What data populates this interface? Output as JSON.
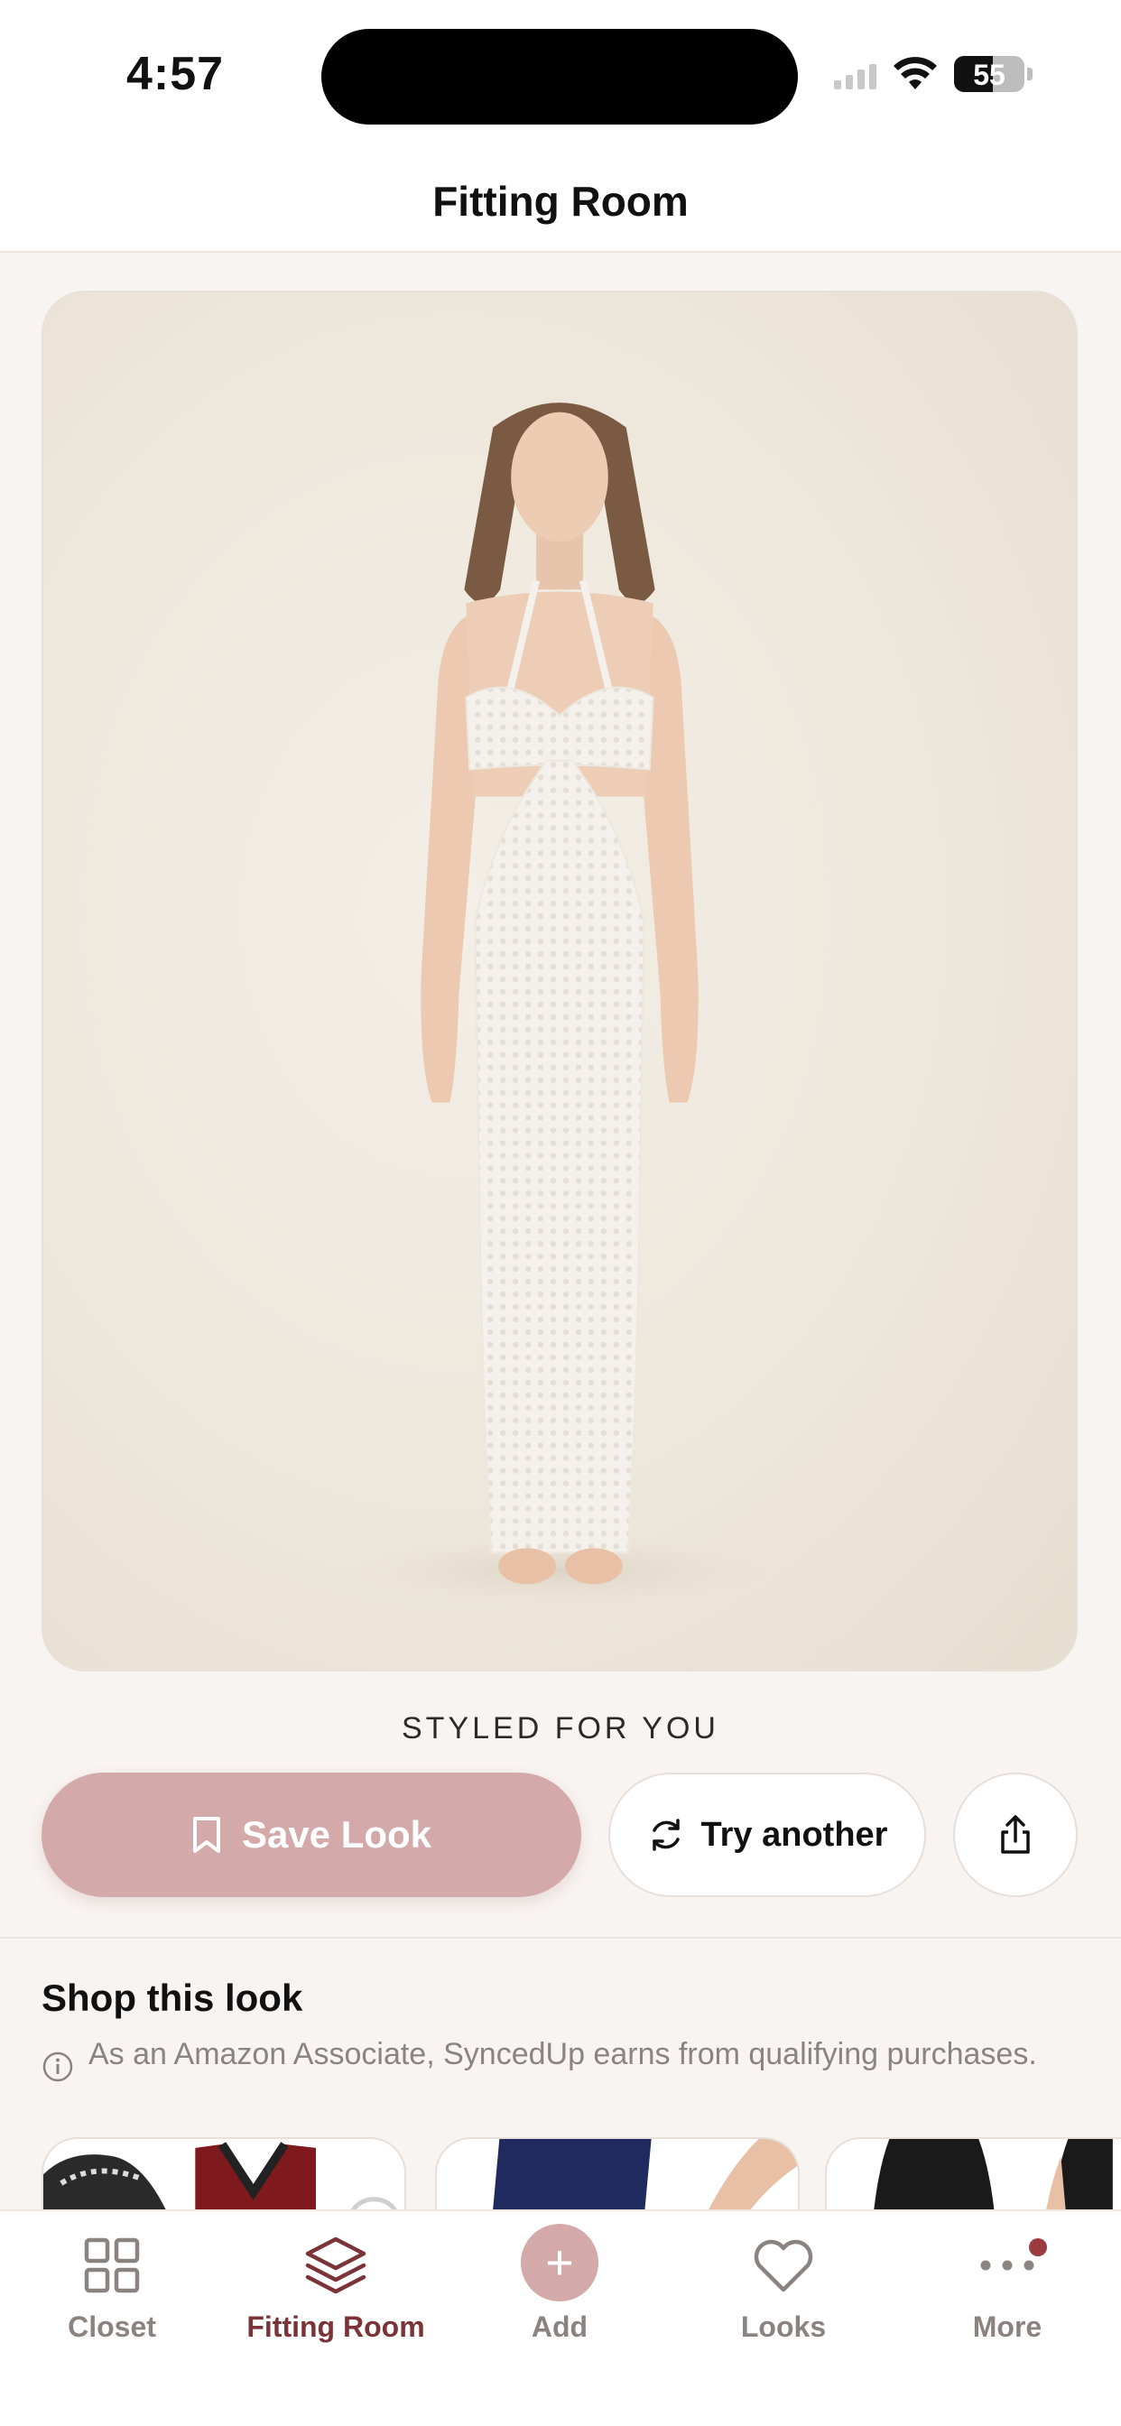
{
  "status_bar": {
    "time": "4:57",
    "battery": "55"
  },
  "header": {
    "title": "Fitting Room"
  },
  "photo": {
    "alt": ""
  },
  "styled_label": "STYLED FOR YOU",
  "actions": {
    "save_label": "Save Look",
    "try_label": "Try another"
  },
  "shop": {
    "title": "Shop this look",
    "disclaimer": "As an Amazon Associate, SyncedUp earns from qualifying purchases."
  },
  "tabs": [
    {
      "label": "Closet"
    },
    {
      "label": "Fitting Room"
    },
    {
      "label": "Add"
    },
    {
      "label": "Looks"
    },
    {
      "label": "More"
    }
  ],
  "colors": {
    "accent": "#d4a9a9",
    "active_tab": "#7a3438",
    "inactive_tab": "#8a8380",
    "badge": "#9b3b3f",
    "background": "#f8f4f1"
  }
}
